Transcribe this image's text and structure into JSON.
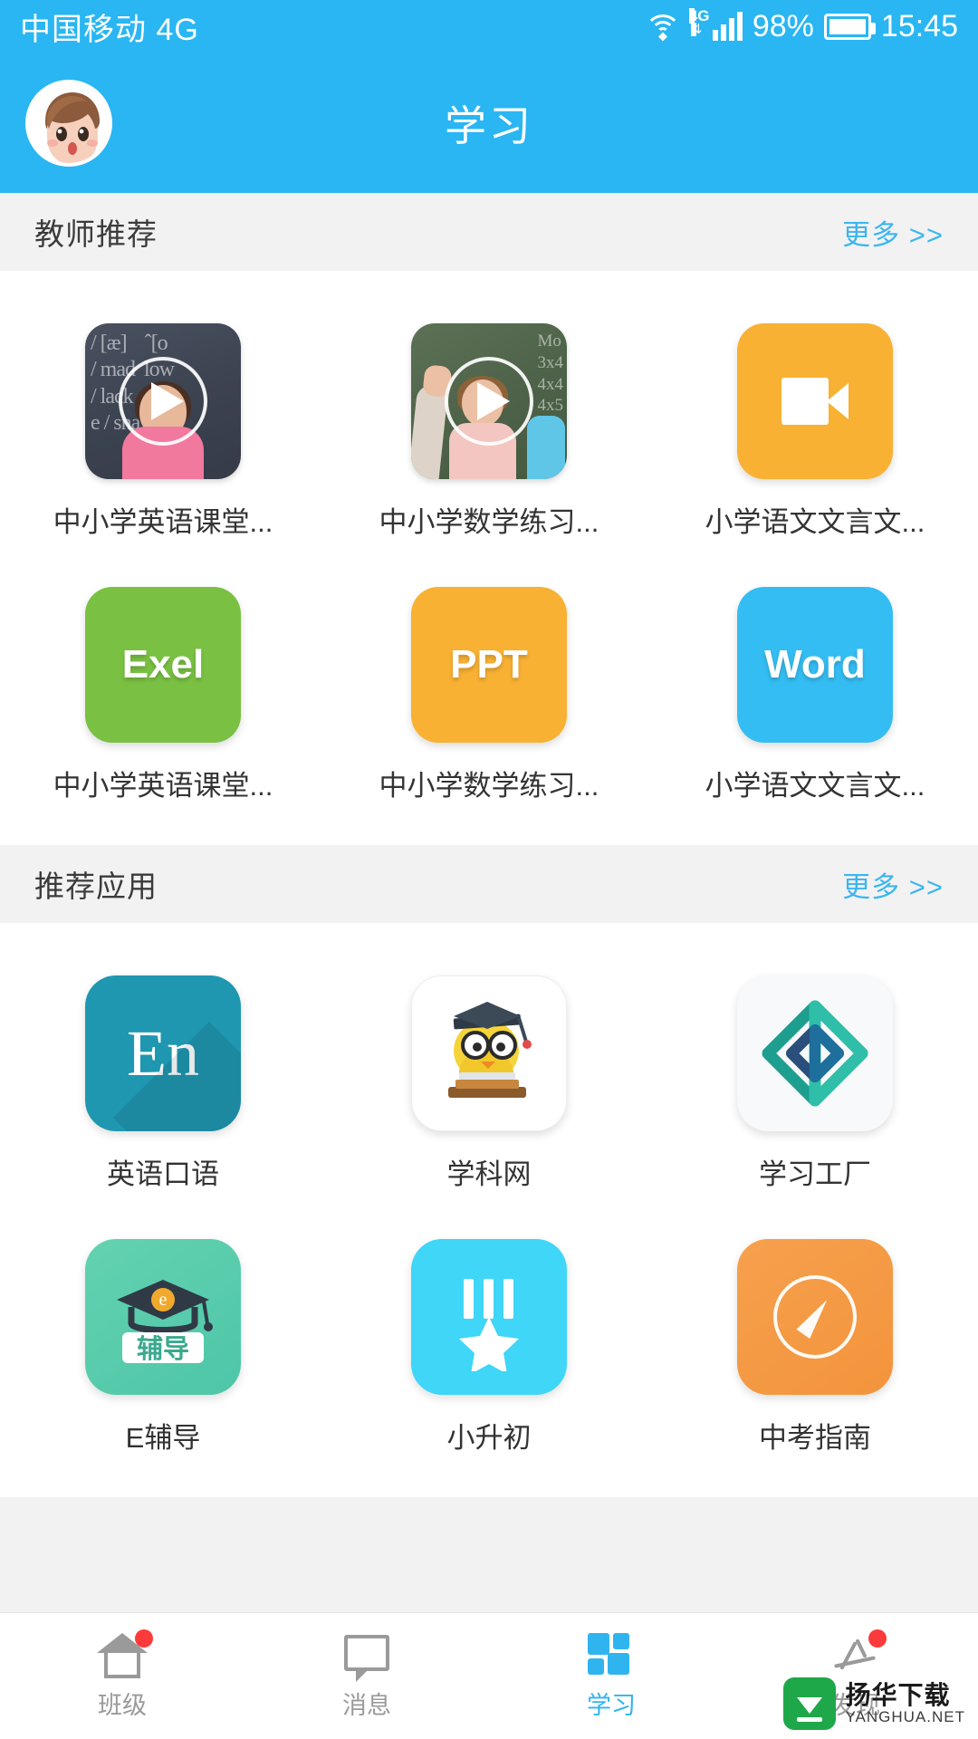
{
  "status_bar": {
    "carrier": "中国移动 4G",
    "wifi_icon": "wifi-icon",
    "network_label": "4G",
    "battery_percent": "98%",
    "battery_icon": "battery-full-icon",
    "time": "15:45"
  },
  "header": {
    "title": "学习",
    "avatar_icon": "user-avatar"
  },
  "sections": [
    {
      "title": "教师推荐",
      "more_label": "更多 >>",
      "rows": [
        [
          {
            "label": "中小学英语课堂...",
            "icon": "video-thumbnail-english",
            "kind": "thumb-english"
          },
          {
            "label": "中小学数学练习...",
            "icon": "video-thumbnail-math",
            "kind": "thumb-math"
          },
          {
            "label": "小学语文文言文...",
            "icon": "video-camera-icon",
            "kind": "tile-video",
            "color": "#f8b133"
          }
        ],
        [
          {
            "label": "中小学英语课堂...",
            "icon": "excel-icon",
            "kind": "tile-text",
            "text": "Exel",
            "color": "#7ac143"
          },
          {
            "label": "中小学数学练习...",
            "icon": "ppt-icon",
            "kind": "tile-text",
            "text": "PPT",
            "color": "#f8b133"
          },
          {
            "label": "小学语文文言文...",
            "icon": "word-icon",
            "kind": "tile-text",
            "text": "Word",
            "color": "#34bdf2"
          }
        ]
      ]
    },
    {
      "title": "推荐应用",
      "more_label": "更多 >>",
      "rows": [
        [
          {
            "label": "英语口语",
            "icon": "english-speaking-icon",
            "kind": "app-en",
            "text": "En",
            "color": "#1f97b0"
          },
          {
            "label": "学科网",
            "icon": "xkw-graduate-bird-icon",
            "kind": "app-xkw",
            "color": "#ffffff"
          },
          {
            "label": "学习工厂",
            "icon": "learning-factory-diamond-icon",
            "kind": "app-lf",
            "color": "#f7f9fa"
          }
        ],
        [
          {
            "label": "E辅导",
            "icon": "e-tutor-mortarboard-icon",
            "kind": "app-efd",
            "color": "#4ec6a8"
          },
          {
            "label": "小升初",
            "icon": "star-ribbon-icon",
            "kind": "app-xsc",
            "color": "#3fd6f7"
          },
          {
            "label": "中考指南",
            "icon": "compass-icon",
            "kind": "app-zkzn",
            "color": "#f3943c"
          }
        ]
      ]
    }
  ],
  "thumb_text": {
    "english_chalk": "/ [æ]      ˆ[o\n/ mad    low\n/ lack    coa\ne / sna    oa",
    "math_chalk": "Mo\n3x4\n4x4\n4x5\n4x6\n4x7"
  },
  "tabbar": {
    "items": [
      {
        "label": "班级",
        "icon": "home-icon",
        "active": false,
        "badge": true
      },
      {
        "label": "消息",
        "icon": "chat-icon",
        "active": false,
        "badge": false
      },
      {
        "label": "学习",
        "icon": "grid-squares-icon",
        "active": true,
        "badge": false
      },
      {
        "label": "发现",
        "icon": "radar-icon",
        "active": false,
        "badge": true
      }
    ]
  },
  "watermark": {
    "name": "扬华下载",
    "domain": "YANGHUA.NET",
    "logo_icon": "download-logo-icon"
  },
  "colors": {
    "brand_blue": "#29b6f2",
    "link_blue": "#3cb5f0",
    "section_bg": "#f2f2f2",
    "badge_red": "#fb3b3b"
  }
}
